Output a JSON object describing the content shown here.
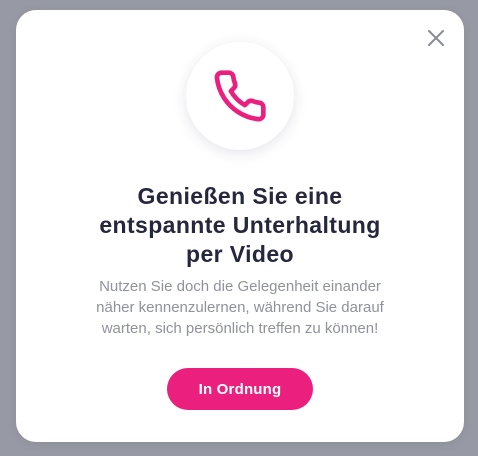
{
  "modal": {
    "close_icon": "close-icon",
    "phone_icon": "phone-icon",
    "title_lines": [
      "Genießen Sie eine",
      "entspannte Unterhaltung",
      "per Video"
    ],
    "description_lines": [
      "Nutzen Sie doch die Gelegenheit einander",
      "näher kennenzulernen, während Sie darauf",
      "warten, sich persönlich treffen zu können!"
    ],
    "ok_label": "In Ordnung"
  },
  "colors": {
    "accent": "#ea1f7e",
    "title": "#25283d",
    "body_text": "#8f929b",
    "backdrop": "#9b9da7",
    "close_icon": "#8a8d96"
  }
}
